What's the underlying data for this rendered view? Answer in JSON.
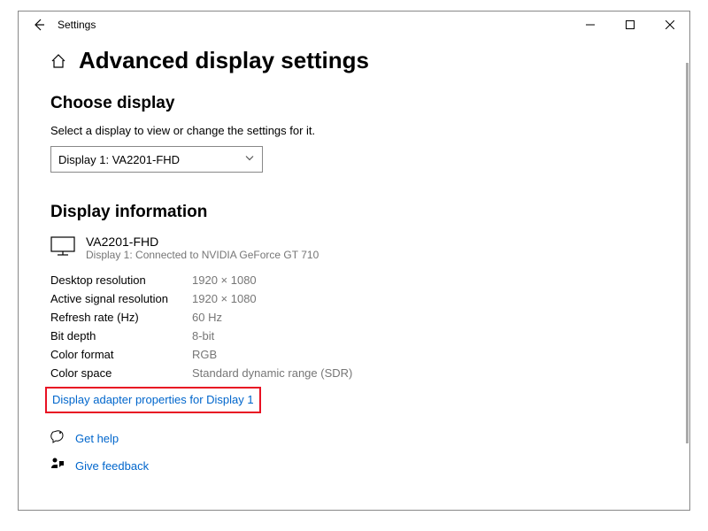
{
  "titlebar": {
    "app_title": "Settings"
  },
  "page": {
    "title": "Advanced display settings"
  },
  "choose_display": {
    "heading": "Choose display",
    "desc": "Select a display to view or change the settings for it.",
    "selected": "Display 1: VA2201-FHD"
  },
  "display_info": {
    "heading": "Display information",
    "monitor_name": "VA2201-FHD",
    "connected": "Display 1: Connected to NVIDIA GeForce GT 710",
    "rows": [
      {
        "label": "Desktop resolution",
        "value": "1920 × 1080"
      },
      {
        "label": "Active signal resolution",
        "value": "1920 × 1080"
      },
      {
        "label": "Refresh rate (Hz)",
        "value": "60 Hz"
      },
      {
        "label": "Bit depth",
        "value": "8-bit"
      },
      {
        "label": "Color format",
        "value": "RGB"
      },
      {
        "label": "Color space",
        "value": "Standard dynamic range (SDR)"
      }
    ],
    "adapter_link": "Display adapter properties for Display 1"
  },
  "footer": {
    "get_help": "Get help",
    "give_feedback": "Give feedback"
  }
}
